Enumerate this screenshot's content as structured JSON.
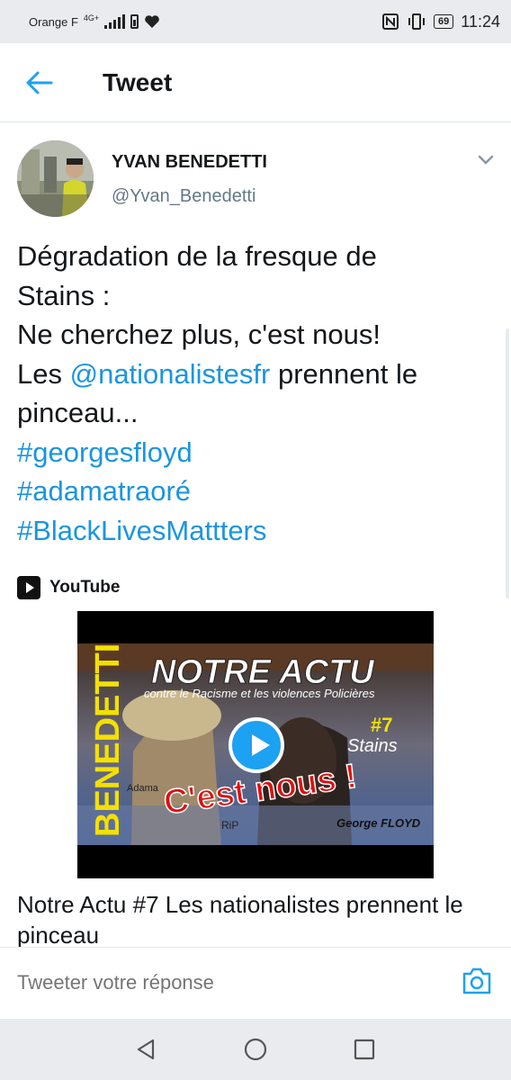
{
  "status_bar": {
    "carrier": "Orange F",
    "network": "4G+",
    "battery": "69",
    "time": "11:24"
  },
  "header": {
    "title": "Tweet",
    "back_icon": "arrow-left-icon"
  },
  "tweet": {
    "display_name": "YVAN BENEDETTI",
    "handle": "@Yvan_Benedetti",
    "text": {
      "line1": "Dégradation de la fresque de",
      "line2": "Stains :",
      "line3": "Ne cherchez plus, c'est nous!",
      "line4_pre": "Les ",
      "mention": "@nationalistesfr",
      "line4_post": " prennent le",
      "line5": "pinceau...",
      "hashtags": [
        "#georgesfloyd",
        "#adamatraoré",
        "#BlackLivesMattters"
      ]
    },
    "card": {
      "source": "YouTube",
      "thumb_text": {
        "name": "BENEDETTI",
        "title": "NOTRE ACTU",
        "subtitle": "contre le Racisme et les violences Policières",
        "number": "#7",
        "place": "Stains",
        "tagline": "C'est nous !",
        "rip": "RiP",
        "george": "George FLOYD",
        "adama": "Adama"
      },
      "title": "Notre Actu #7 Les nationalistes prennent le pinceau"
    }
  },
  "reply": {
    "placeholder": "Tweeter votre réponse"
  },
  "colors": {
    "accent": "#1da1f2",
    "link": "#1b95e0",
    "text": "#14171a",
    "muted": "#657786"
  }
}
